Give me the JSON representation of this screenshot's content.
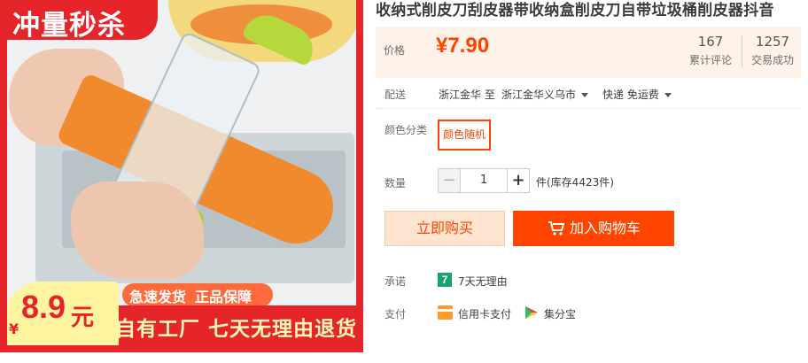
{
  "image": {
    "top_banner": "冲量秒杀",
    "badge_currency": "¥",
    "badge_price": "8.9",
    "badge_unit": "元",
    "pill_fast": "急速发货",
    "pill_genuine": "正品保障",
    "bottom_banner": "自有工厂  七天无理由退货"
  },
  "title": "收纳式削皮刀刮皮器带收纳盒削皮刀自带垃圾桶削皮器抖音",
  "price": {
    "label": "价格",
    "value": "¥7.90",
    "reviews_count": "167",
    "reviews_label": "累计评论",
    "sales_count": "1257",
    "sales_label": "交易成功"
  },
  "shipping": {
    "label": "配送",
    "origin": "浙江金华 至",
    "destination": "浙江金华义乌市",
    "method": "快递 免运费"
  },
  "color": {
    "label": "颜色分类",
    "selected": "颜色随机"
  },
  "quantity": {
    "label": "数量",
    "minus": "−",
    "value": "1",
    "plus": "+",
    "stock": "件(库存4423件)"
  },
  "actions": {
    "buy_now": "立即购买",
    "add_to_cart": "加入购物车"
  },
  "promise": {
    "label": "承诺",
    "icon_text": "7",
    "text": "7天无理由"
  },
  "payment": {
    "label": "支付",
    "credit_card": "信用卡支付",
    "jifenbao": "集分宝"
  },
  "colors": {
    "accent": "#ff4400",
    "banner_red": "#e6252a",
    "price_bg": "#fff2e8",
    "promise_green": "#1aa36f"
  }
}
